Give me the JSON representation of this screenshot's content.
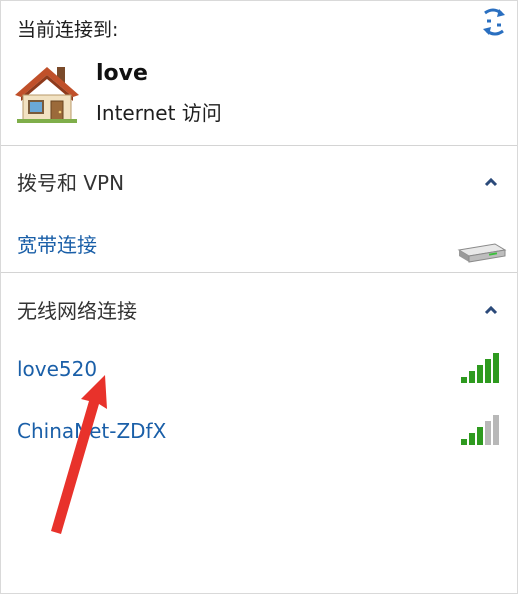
{
  "current": {
    "header": "当前连接到:",
    "network_name": "love",
    "network_status": "Internet 访问"
  },
  "dialup": {
    "title": "拨号和 VPN",
    "items": [
      {
        "label": "宽带连接",
        "icon": "broadband-modem-icon"
      }
    ]
  },
  "wireless": {
    "title": "无线网络连接",
    "networks": [
      {
        "label": "love520",
        "signal_bars": 5,
        "signal_max": 5
      },
      {
        "label": "ChinaNet-ZDfX",
        "signal_bars": 3,
        "signal_max": 5
      }
    ]
  },
  "icons": {
    "refresh": "refresh-arrows-icon",
    "house": "house-icon",
    "collapse": "chevron-up-icon",
    "annotation": "red-arrow-annotation"
  },
  "colors": {
    "link": "#1a5fa8",
    "signal_on": "#2e9a1f",
    "signal_off": "#b8b8b8",
    "annotation": "#e8322b",
    "divider": "#d4d4d4"
  }
}
